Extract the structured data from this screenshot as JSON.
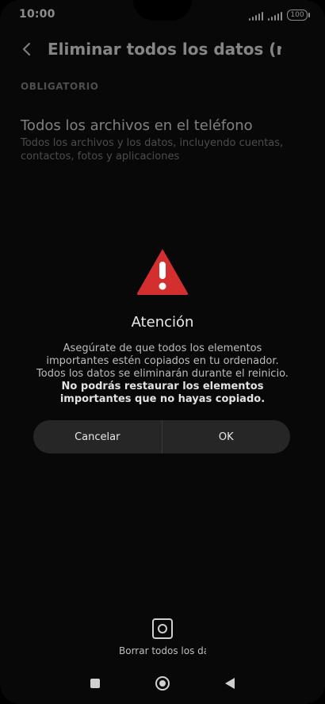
{
  "status": {
    "time": "10:00",
    "battery": "100"
  },
  "header": {
    "title": "Eliminar todos los datos (resete"
  },
  "content": {
    "section_label": "OBLIGATORIO",
    "row_title": "Todos los archivos en el teléfono",
    "row_subtitle": "Todos los archivos y los datos, incluyendo cuentas, contactos, fotos y aplicaciones"
  },
  "dialog": {
    "title": "Atención",
    "message_normal": "Asegúrate de que todos los elementos importantes estén copiados en tu ordenador. Todos los datos se eliminarán durante el reinicio. ",
    "message_bold": "No podrás restaurar los elementos importantes que no hayas copiado.",
    "cancel_label": "Cancelar",
    "ok_label": "OK"
  },
  "bottom_action": {
    "label": "Borrar todos los datos"
  },
  "colors": {
    "warning": "#d32f2f",
    "background": "#0f0f10",
    "button_bg": "#262626"
  },
  "icons": {
    "back": "chevron-left-icon",
    "warning": "warning-triangle-icon",
    "reset": "reset-device-icon"
  }
}
